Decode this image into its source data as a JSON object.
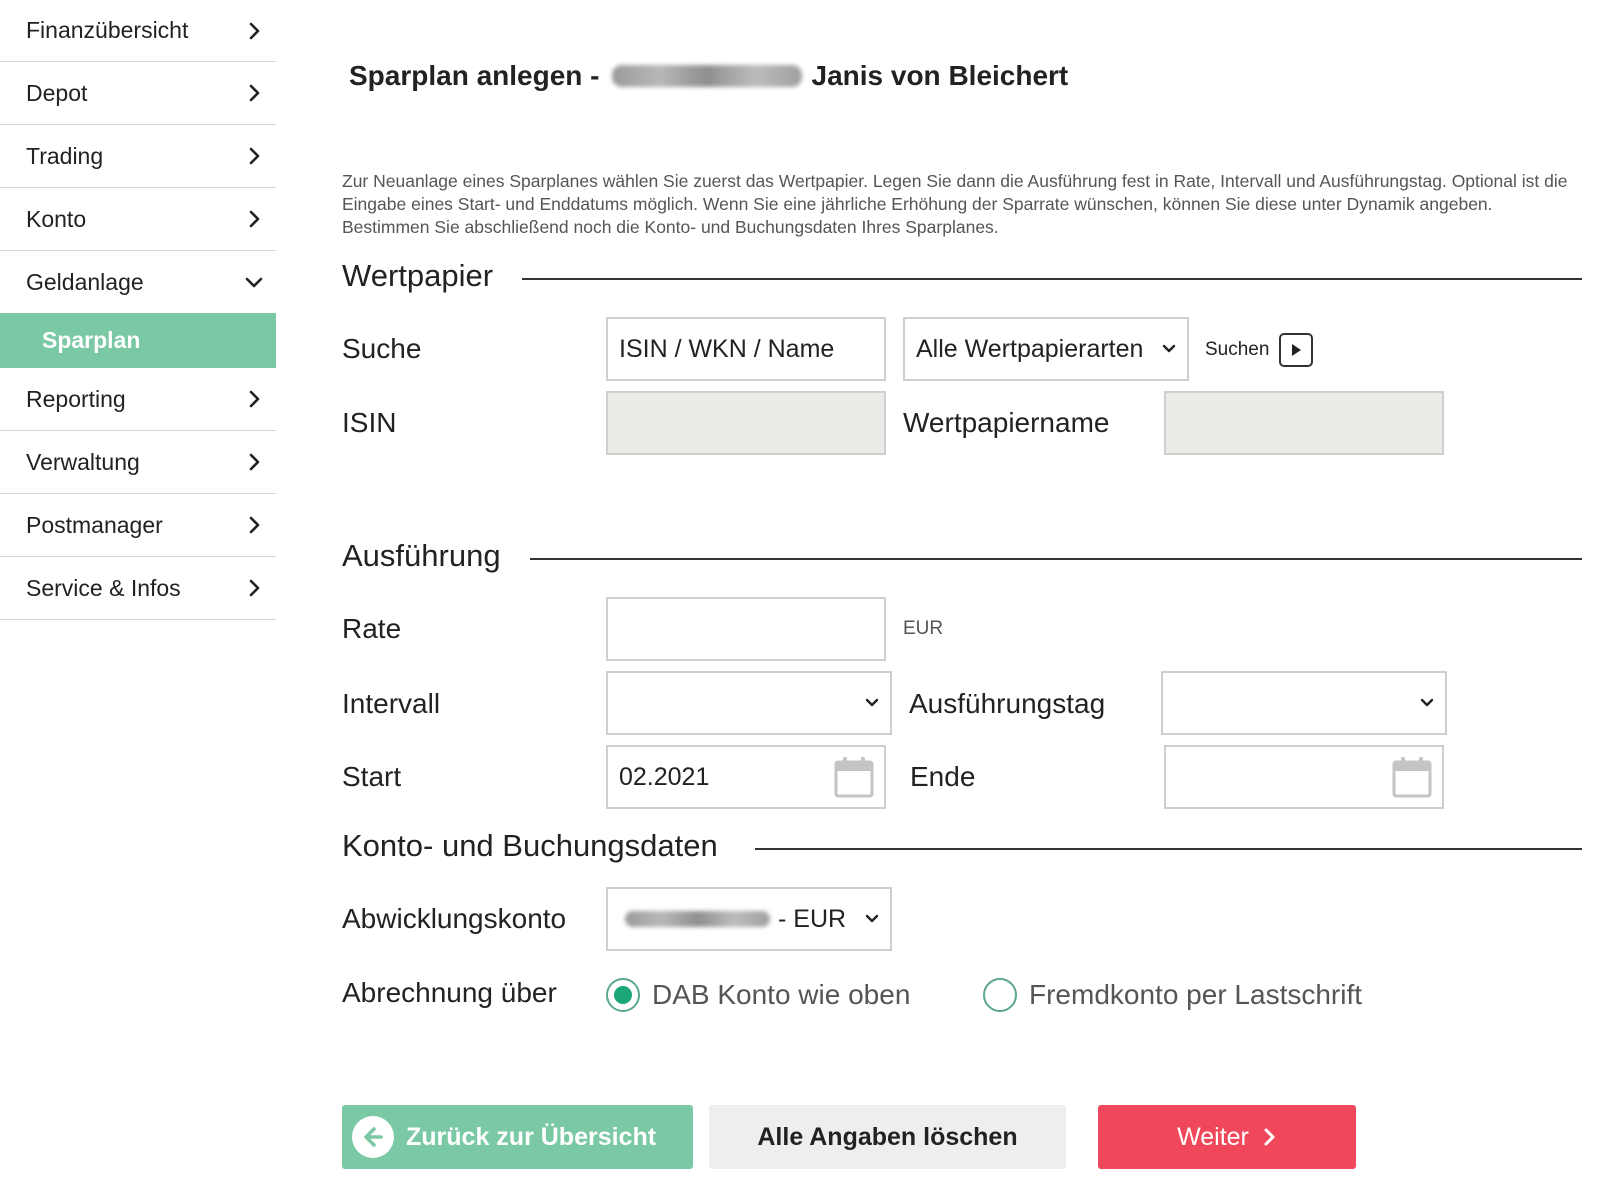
{
  "sidebar": {
    "items": [
      {
        "label": "Finanzübersicht"
      },
      {
        "label": "Depot"
      },
      {
        "label": "Trading"
      },
      {
        "label": "Konto"
      },
      {
        "label": "Geldanlage"
      },
      {
        "label": "Reporting"
      },
      {
        "label": "Verwaltung"
      },
      {
        "label": "Postmanager"
      },
      {
        "label": "Service & Infos"
      }
    ],
    "active_sub": "Sparplan"
  },
  "header": {
    "title_prefix": "Sparplan anlegen -",
    "title_name": "Janis von Bleichert"
  },
  "intro": "Zur Neuanlage eines Sparplanes wählen Sie zuerst das Wertpapier. Legen Sie dann die Ausführung fest in Rate, Intervall und Ausführungstag. Optional ist die Eingabe eines Start- und Enddatums möglich. Wenn Sie eine jährliche Erhöhung der Sparrate wünschen, können Sie diese unter Dynamik angeben. Bestimmen Sie abschließend noch die Konto- und Buchungsdaten Ihres Sparplanes.",
  "wertpapier": {
    "title": "Wertpapier",
    "suche_label": "Suche",
    "search_placeholder": "ISIN / WKN / Name",
    "type_select": "Alle Wertpapierarten",
    "search_button": "Suchen",
    "isin_label": "ISIN",
    "name_label": "Wertpapiername"
  },
  "ausfuehrung": {
    "title": "Ausführung",
    "rate_label": "Rate",
    "rate_unit": "EUR",
    "intervall_label": "Intervall",
    "tag_label": "Ausführungstag",
    "start_label": "Start",
    "start_value": "02.2021",
    "ende_label": "Ende"
  },
  "konto": {
    "title": "Konto- und Buchungsdaten",
    "abwicklung_label": "Abwicklungskonto",
    "abwicklung_suffix": "- EUR",
    "abrechnung_label": "Abrechnung über",
    "option_dab": "DAB Konto wie oben",
    "option_fremd": "Fremdkonto per Lastschrift"
  },
  "buttons": {
    "back": "Zurück zur Übersicht",
    "clear": "Alle Angaben löschen",
    "next": "Weiter"
  },
  "colors": {
    "accent_green": "#7bc8a4",
    "radio_green": "#1ca778",
    "primary_red": "#f0485a"
  }
}
